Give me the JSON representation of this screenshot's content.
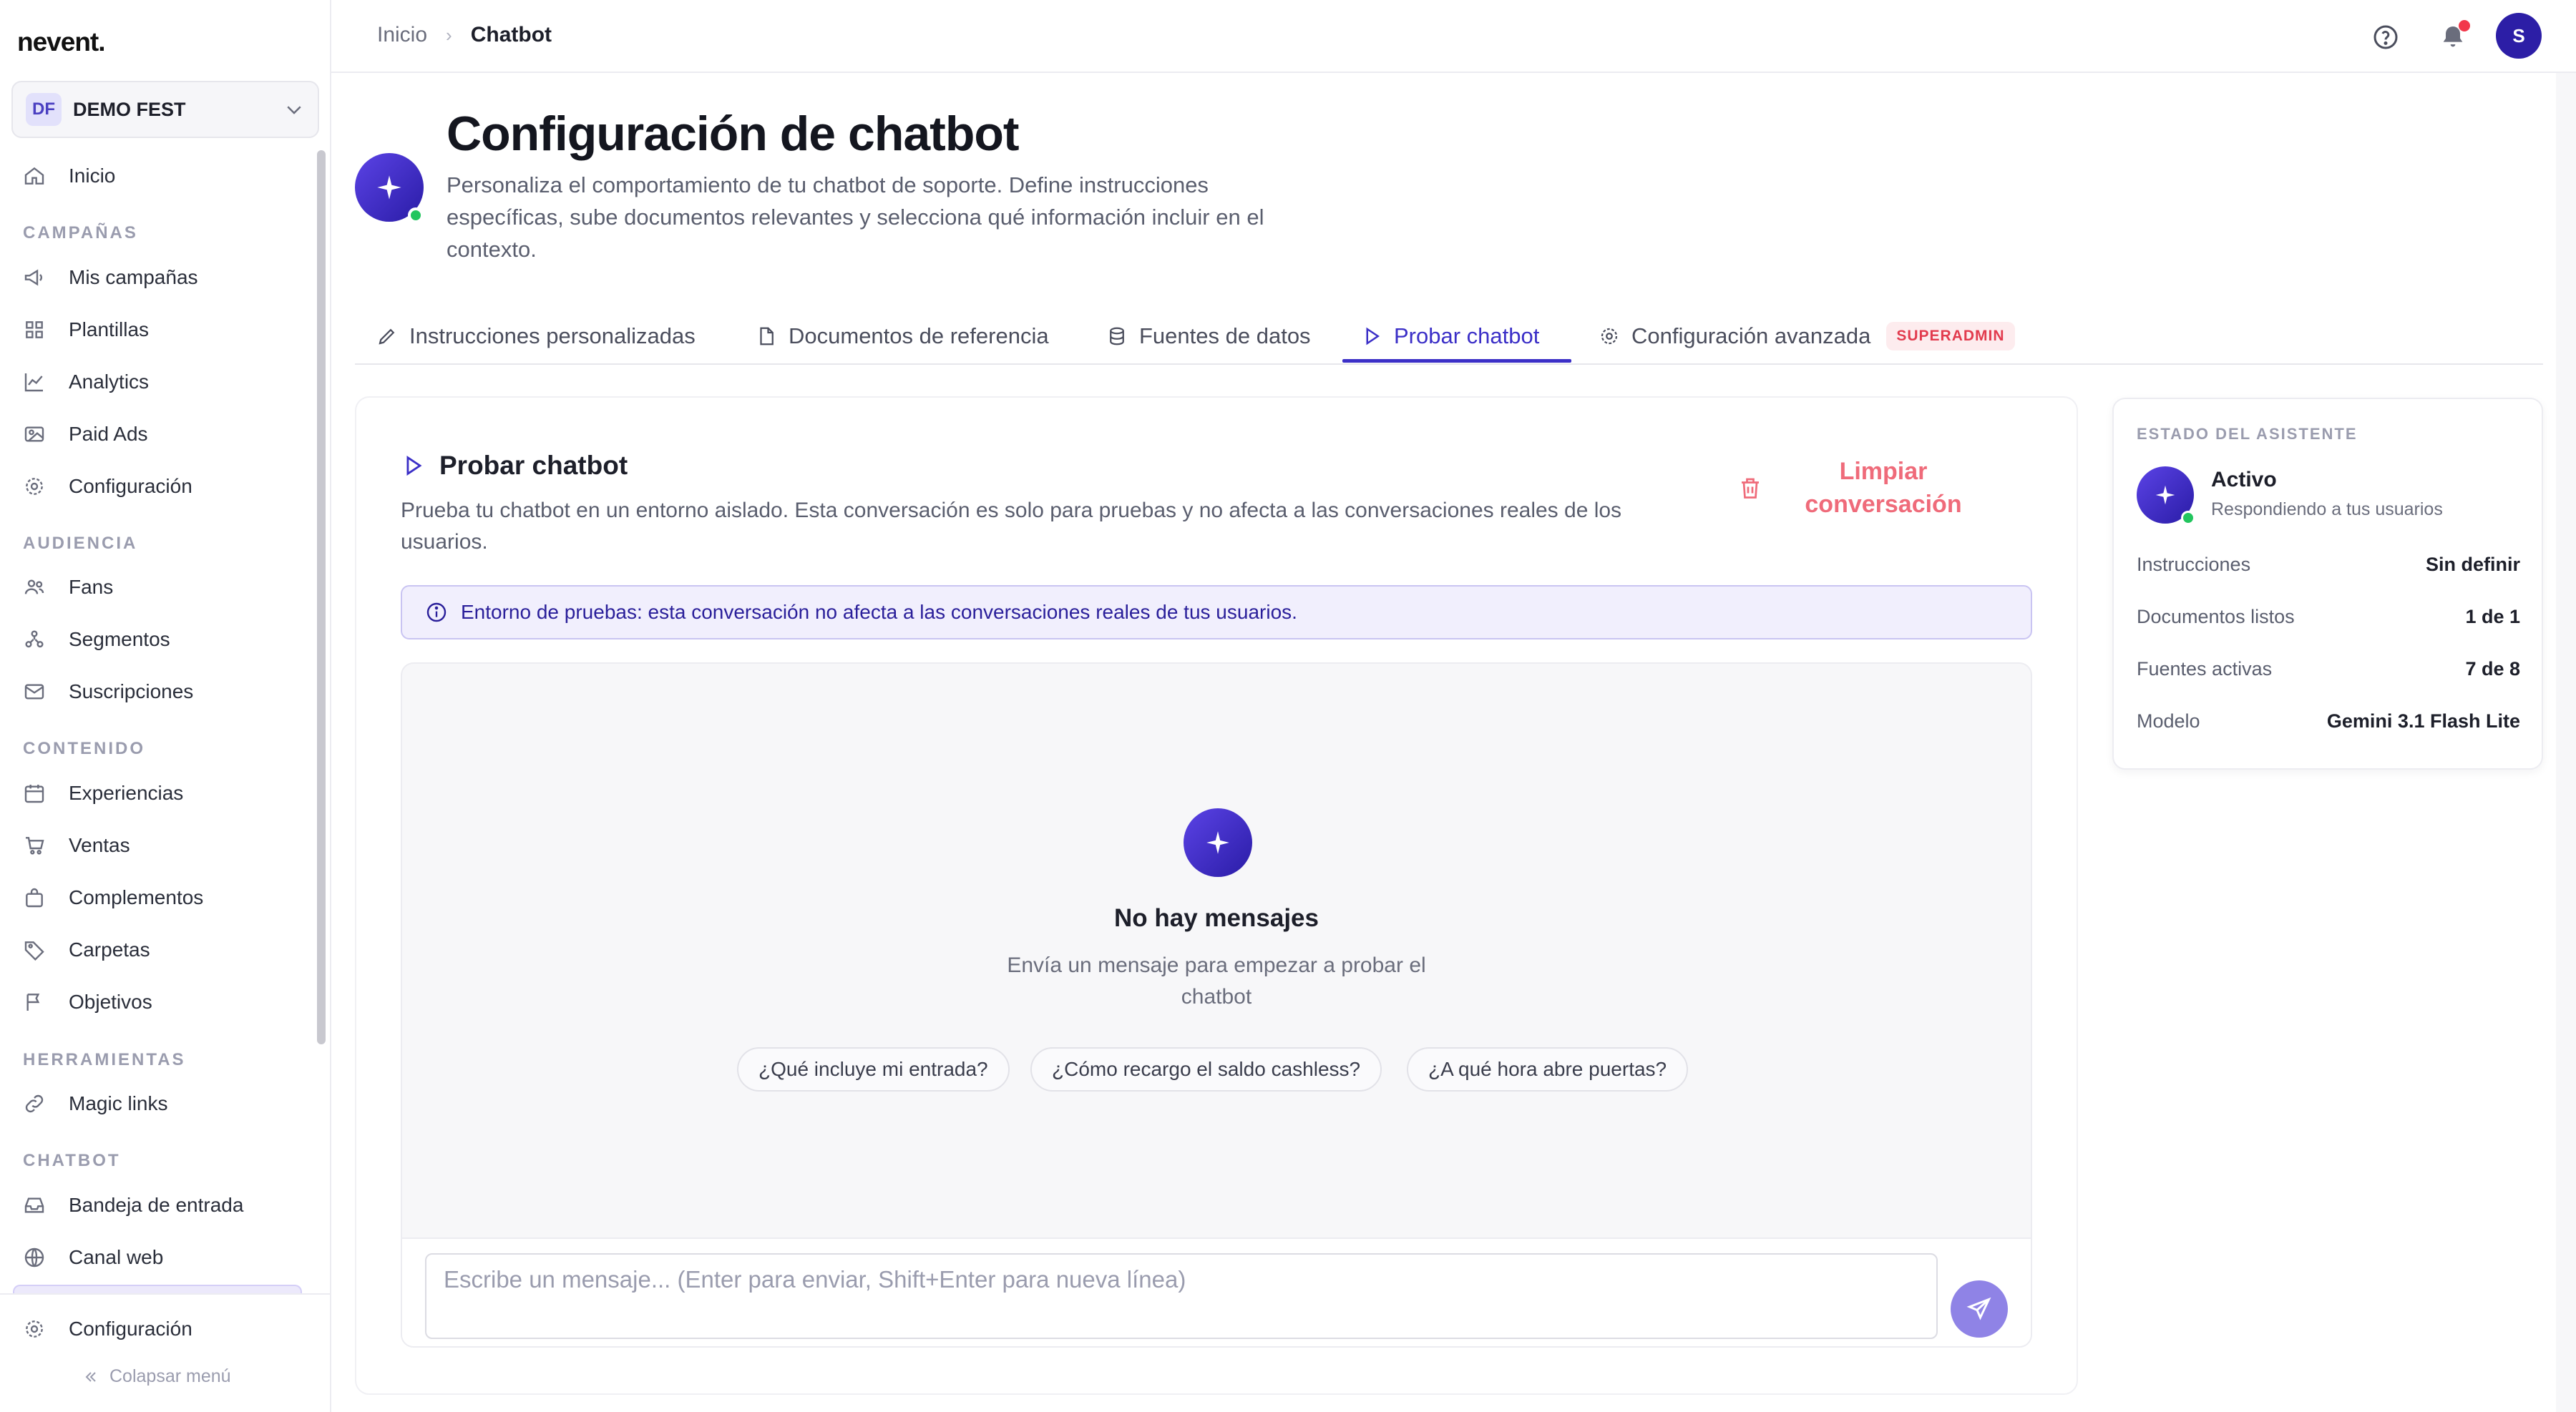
{
  "app": {
    "logo": "nevent."
  },
  "workspace": {
    "initials": "DF",
    "name": "DEMO FEST"
  },
  "sidebar": {
    "home": "Inicio",
    "sections": {
      "campaigns": "CAMPAÑAS",
      "audience": "AUDIENCIA",
      "content": "CONTENIDO",
      "tools": "HERRAMIENTAS",
      "chatbot": "CHATBOT"
    },
    "items": {
      "mis_campanas": "Mis campañas",
      "plantillas": "Plantillas",
      "analytics": "Analytics",
      "paid_ads": "Paid Ads",
      "configuracion": "Configuración",
      "fans": "Fans",
      "segmentos": "Segmentos",
      "suscripciones": "Suscripciones",
      "experiencias": "Experiencias",
      "ventas": "Ventas",
      "complementos": "Complementos",
      "carpetas": "Carpetas",
      "objetivos": "Objetivos",
      "magic_links": "Magic links",
      "bandeja": "Bandeja de entrada",
      "canal_web": "Canal web"
    },
    "bottom_config": "Configuración",
    "collapse": "Colapsar menú"
  },
  "topbar": {
    "breadcrumb_home": "Inicio",
    "breadcrumb_sep": "›",
    "breadcrumb_current": "Chatbot",
    "avatar_initial": "S"
  },
  "header": {
    "title": "Configuración de chatbot",
    "description": "Personaliza el comportamiento de tu chatbot de soporte. Define instrucciones específicas, sube documentos relevantes y selecciona qué información incluir en el contexto."
  },
  "tabs": {
    "instrucciones": "Instrucciones personalizadas",
    "documentos": "Documentos de referencia",
    "fuentes": "Fuentes de datos",
    "probar": "Probar chatbot",
    "avanzada": "Configuración avanzada",
    "superadmin_badge": "SUPERADMIN"
  },
  "test": {
    "title": "Probar chatbot",
    "description": "Prueba tu chatbot en un entorno aislado. Esta conversación es solo para pruebas y no afecta a las conversaciones reales de los usuarios.",
    "clear_button": "Limpiar conversación",
    "info": "Entorno de pruebas: esta conversación no afecta a las conversaciones reales de tus usuarios.",
    "empty_title": "No hay mensajes",
    "empty_desc": "Envía un mensaje para empezar a probar el chatbot",
    "suggestions": [
      "¿Qué incluye mi entrada?",
      "¿Cómo recargo el saldo cashless?",
      "¿A qué hora abre puertas?"
    ],
    "input_placeholder": "Escribe un mensaje... (Enter para enviar, Shift+Enter para nueva línea)"
  },
  "status": {
    "title": "ESTADO DEL ASISTENTE",
    "state": "Activo",
    "state_sub": "Respondiendo a tus usuarios",
    "rows": [
      {
        "label": "Instrucciones",
        "value": "Sin definir"
      },
      {
        "label": "Documentos listos",
        "value": "1 de 1"
      },
      {
        "label": "Fuentes activas",
        "value": "7 de 8"
      },
      {
        "label": "Modelo",
        "value": "Gemini 3.1 Flash Lite"
      }
    ]
  },
  "colors": {
    "accent": "#3b2fc7",
    "danger": "#ef6b7a",
    "online": "#22c55e"
  }
}
